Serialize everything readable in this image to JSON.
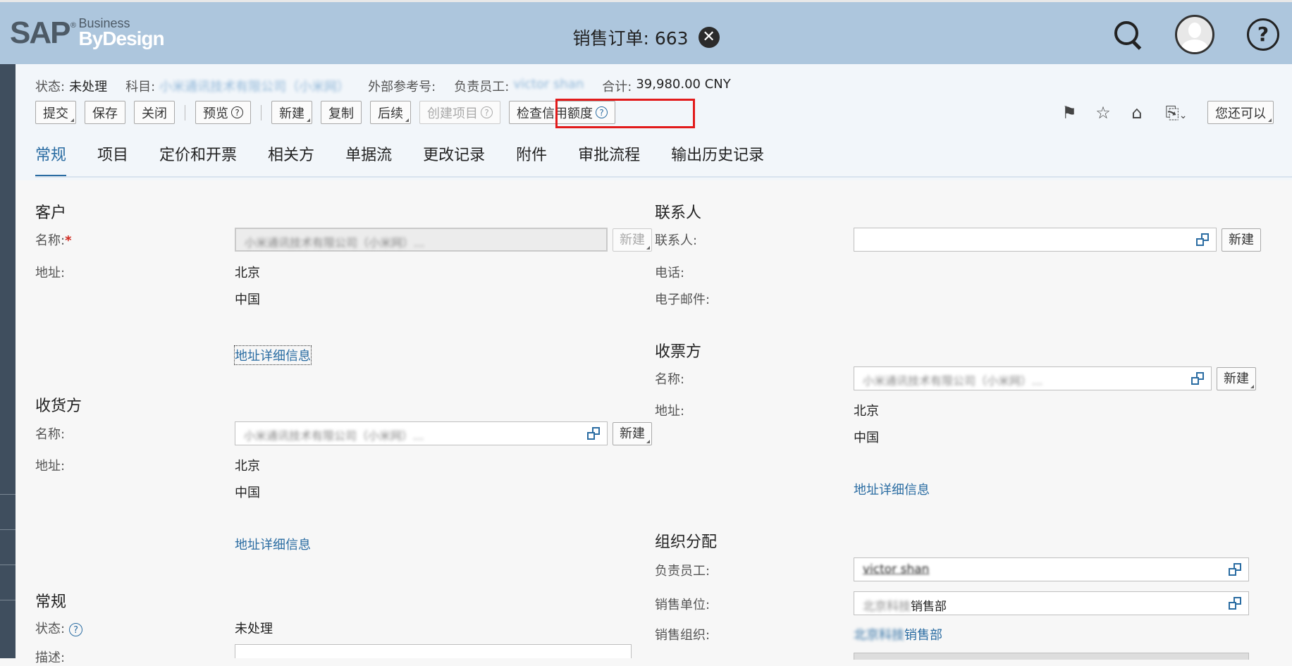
{
  "header": {
    "brand": "SAP",
    "brand_business": "Business",
    "brand_bydesign": "ByDesign",
    "title": "销售订单: 663"
  },
  "status_line": {
    "status_label": "状态:",
    "status_value": "未处理",
    "account_label": "科目:",
    "account_value": "小米通讯技术有限公司（小米网）",
    "ext_ref_label": "外部参考号:",
    "owner_label": "负责员工:",
    "owner_value": "victor shan",
    "total_label": "合计:",
    "total_value": "39,980.00 CNY"
  },
  "toolbar": {
    "submit": "提交",
    "save": "保存",
    "close": "关闭",
    "preview": "预览",
    "new": "新建",
    "copy": "复制",
    "followup": "后续",
    "create_item": "创建项目",
    "check_credit": "检查信用额度",
    "you_can_also": "您还可以"
  },
  "right_icons": [
    "flag-icon",
    "star-icon",
    "tag-icon",
    "new-document-icon"
  ],
  "tabs": [
    "常规",
    "项目",
    "定价和开票",
    "相关方",
    "单据流",
    "更改记录",
    "附件",
    "审批流程",
    "输出历史记录"
  ],
  "customer": {
    "section": "客户",
    "name_label": "名称:",
    "name_value": "小米通讯技术有限公司（小米网）...",
    "new_button": "新建",
    "address_label": "地址:",
    "city": "北京",
    "country": "中国",
    "address_details_link": "地址详细信息"
  },
  "ship_to": {
    "section": "收货方",
    "name_label": "名称:",
    "name_value": "小米通讯技术有限公司（小米网）...",
    "new_button": "新建",
    "address_label": "地址:",
    "city": "北京",
    "country": "中国",
    "address_details_link": "地址详细信息"
  },
  "general": {
    "section": "常规",
    "status_label": "状态:",
    "status_value": "未处理",
    "desc_label": "描述:"
  },
  "contact": {
    "section": "联系人",
    "contact_label": "联系人:",
    "contact_value": "",
    "new_button": "新建",
    "phone_label": "电话:",
    "email_label": "电子邮件:"
  },
  "bill_to": {
    "section": "收票方",
    "name_label": "名称:",
    "name_value": "小米通讯技术有限公司（小米网）...",
    "new_button": "新建",
    "address_label": "地址:",
    "city": "北京",
    "country": "中国",
    "address_details_link": "地址详细信息"
  },
  "org": {
    "section": "组织分配",
    "owner_label": "负责员工:",
    "owner_value": "victor shan",
    "sales_unit_label": "销售单位:",
    "sales_unit_prefix": "北京科技",
    "sales_unit_value": "销售部",
    "sales_org_label": "销售组织:",
    "sales_org_prefix": "北京科技",
    "sales_org_value": "销售部"
  }
}
